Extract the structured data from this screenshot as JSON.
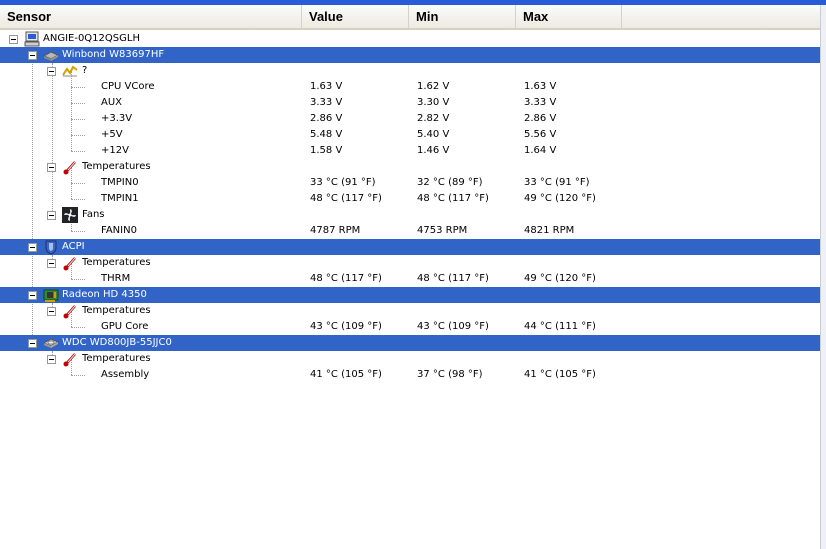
{
  "columns": {
    "sensor": "Sensor",
    "value": "Value",
    "min": "Min",
    "max": "Max"
  },
  "colors": {
    "selection": "#3264c8",
    "header_bg": "#ebeae3",
    "title_blue": "#2a5bd7"
  },
  "tree": {
    "root": {
      "label": "ANGIE-0Q12QSGLH",
      "icon": "computer-icon"
    },
    "winbond": {
      "label": "Winbond W83697HF",
      "icon": "chip-icon",
      "voltages": {
        "label": "?",
        "icon": "voltage-graph-icon",
        "rows": [
          {
            "name": "CPU VCore",
            "value": "1.63 V",
            "min": "1.62 V",
            "max": "1.63 V"
          },
          {
            "name": "AUX",
            "value": "3.33 V",
            "min": "3.30 V",
            "max": "3.33 V"
          },
          {
            "name": "+3.3V",
            "value": "2.86 V",
            "min": "2.82 V",
            "max": "2.86 V"
          },
          {
            "name": "+5V",
            "value": "5.48 V",
            "min": "5.40 V",
            "max": "5.56 V"
          },
          {
            "name": "+12V",
            "value": "1.58 V",
            "min": "1.46 V",
            "max": "1.64 V"
          }
        ]
      },
      "temperatures": {
        "label": "Temperatures",
        "icon": "thermometer-icon",
        "rows": [
          {
            "name": "TMPIN0",
            "value": "33 °C  (91 °F)",
            "min": "32 °C  (89 °F)",
            "max": "33 °C  (91 °F)"
          },
          {
            "name": "TMPIN1",
            "value": "48 °C  (117 °F)",
            "min": "48 °C  (117 °F)",
            "max": "49 °C  (120 °F)"
          }
        ]
      },
      "fans": {
        "label": "Fans",
        "icon": "fan-icon",
        "rows": [
          {
            "name": "FANIN0",
            "value": "4787 RPM",
            "min": "4753 RPM",
            "max": "4821 RPM"
          }
        ]
      }
    },
    "acpi": {
      "label": "ACPI",
      "icon": "shield-icon",
      "temperatures": {
        "label": "Temperatures",
        "icon": "thermometer-icon",
        "rows": [
          {
            "name": "THRM",
            "value": "48 °C  (117 °F)",
            "min": "48 °C  (117 °F)",
            "max": "49 °C  (120 °F)"
          }
        ]
      }
    },
    "radeon": {
      "label": "Radeon HD 4350",
      "icon": "graphics-card-icon",
      "temperatures": {
        "label": "Temperatures",
        "icon": "thermometer-icon",
        "rows": [
          {
            "name": "GPU Core",
            "value": "43 °C  (109 °F)",
            "min": "43 °C  (109 °F)",
            "max": "44 °C  (111 °F)"
          }
        ]
      }
    },
    "wdc": {
      "label": "WDC WD800JB-55JJC0",
      "icon": "hard-drive-icon",
      "temperatures": {
        "label": "Temperatures",
        "icon": "thermometer-icon",
        "rows": [
          {
            "name": "Assembly",
            "value": "41 °C  (105 °F)",
            "min": "37 °C  (98 °F)",
            "max": "41 °C  (105 °F)"
          }
        ]
      }
    }
  }
}
